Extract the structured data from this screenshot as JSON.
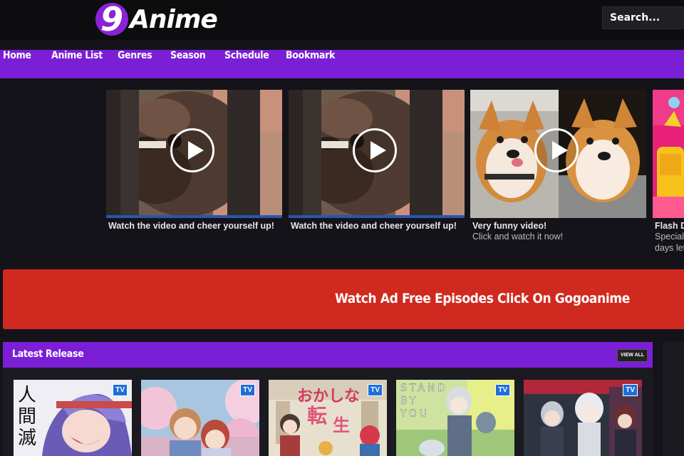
{
  "header": {
    "logo_mark": "9",
    "logo_text": "Anime",
    "search_placeholder": "Search..."
  },
  "nav": {
    "items": [
      {
        "label": "Home"
      },
      {
        "label": "Anime List"
      },
      {
        "label": "Genres"
      },
      {
        "label": "Season"
      },
      {
        "label": "Schedule"
      },
      {
        "label": "Bookmark"
      }
    ]
  },
  "ads": [
    {
      "title": "Watch the video and cheer yourself up!",
      "subtitle": ""
    },
    {
      "title": "Watch the video and cheer yourself up!",
      "subtitle": ""
    },
    {
      "title": "Very funny video!",
      "subtitle": "Click and watch it now!"
    },
    {
      "title": "Flash D",
      "subtitle": "Special",
      "subtitle2": "days let"
    }
  ],
  "banner": {
    "text": "Watch Ad Free Episodes Click On Gogoanime"
  },
  "latest": {
    "title": "Latest Release",
    "view_all": "VIEW ALL",
    "badge": "TV",
    "cards": [
      {
        "badge": "TV",
        "cover_text": "人間滅"
      },
      {
        "badge": "TV",
        "cover_text": ""
      },
      {
        "badge": "TV",
        "cover_text": "おかしな転生"
      },
      {
        "badge": "TV",
        "cover_text": "STAND BY YOU"
      },
      {
        "badge": "TV",
        "cover_text": ""
      }
    ]
  },
  "colors": {
    "accent_purple": "#7b1fd6",
    "banner_red": "#d0291f",
    "background": "#14131a",
    "badge_blue": "#1e6fd8"
  }
}
